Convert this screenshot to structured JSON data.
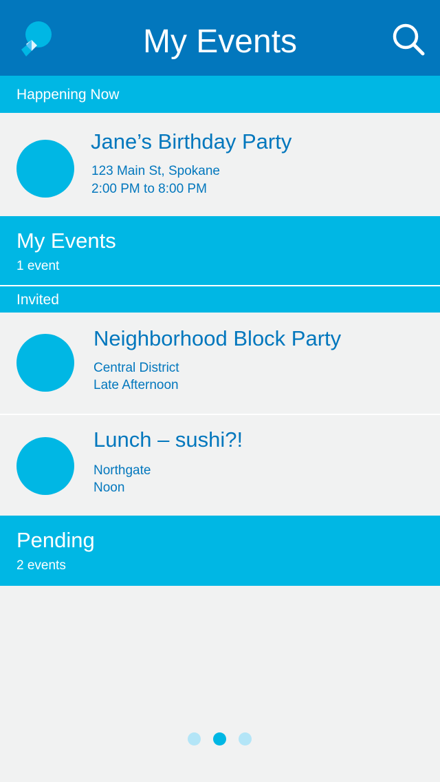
{
  "header": {
    "title": "My Events",
    "logo_icon": "chat-bubble-logo-icon",
    "search_icon": "search-icon"
  },
  "sections": {
    "happening_now": {
      "label": "Happening Now"
    },
    "my_events": {
      "title": "My Events",
      "count": "1 event"
    },
    "invited": {
      "label": "Invited"
    },
    "pending": {
      "title": "Pending",
      "count": "2 events"
    }
  },
  "events": {
    "happening": {
      "title": "Jane’s Birthday Party",
      "location": "123 Main St, Spokane",
      "time": "2:00 PM to 8:00 PM"
    },
    "invited": [
      {
        "title": "Neighborhood Block Party",
        "location": "Central District",
        "time": "Late Afternoon"
      },
      {
        "title": "Lunch – sushi?!",
        "location": "Northgate",
        "time": "Noon"
      }
    ]
  },
  "pager": {
    "pages": 3,
    "current": 2
  },
  "colors": {
    "header_bg": "#0277bd",
    "accent": "#00b7e4",
    "text_blue": "#0277bd",
    "background": "#f1f2f2",
    "dot_inactive": "#b3e5f7"
  }
}
